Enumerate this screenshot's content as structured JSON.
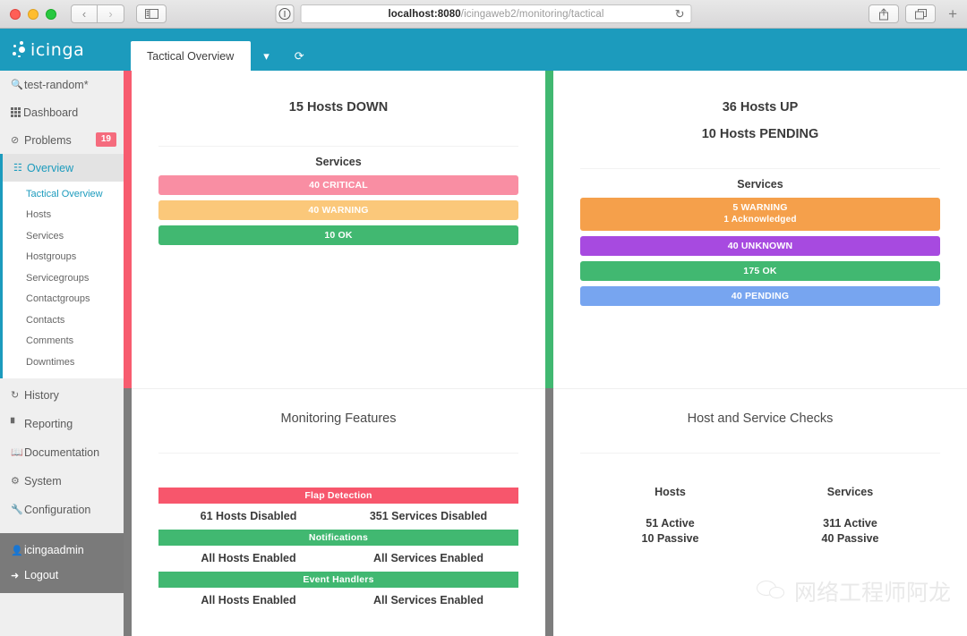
{
  "browser": {
    "back_label": "‹",
    "forward_label": "›",
    "sidebar_toggle_label": "sidebar-toggle",
    "url_host": "localhost:8080",
    "url_path": "/icingaweb2/monitoring/tactical",
    "reload_label": "↻",
    "share_label": "share",
    "tabs_label": "tabs",
    "new_tab_label": "+"
  },
  "sidebar": {
    "logo_text": "icinga",
    "search": {
      "icon": "search-icon",
      "value": "test-random*"
    },
    "items": [
      {
        "label": "Dashboard",
        "icon": "grid-icon"
      },
      {
        "label": "Problems",
        "icon": "ban-icon",
        "badge": "19"
      },
      {
        "label": "Overview",
        "icon": "sitemap-icon",
        "active": true
      }
    ],
    "submenu": [
      {
        "label": "Tactical Overview",
        "current": true
      },
      {
        "label": "Hosts"
      },
      {
        "label": "Services"
      },
      {
        "label": "Hostgroups"
      },
      {
        "label": "Servicegroups"
      },
      {
        "label": "Contactgroups"
      },
      {
        "label": "Contacts"
      },
      {
        "label": "Comments"
      },
      {
        "label": "Downtimes"
      }
    ],
    "lower_items": [
      {
        "label": "History",
        "icon": "history-icon"
      },
      {
        "label": "Reporting",
        "icon": "bar-chart-icon"
      },
      {
        "label": "Documentation",
        "icon": "book-icon"
      },
      {
        "label": "System",
        "icon": "gears-icon"
      },
      {
        "label": "Configuration",
        "icon": "wrench-icon"
      }
    ],
    "user": {
      "label": "icingaadmin",
      "icon": "user-icon"
    },
    "logout": {
      "label": "Logout",
      "icon": "logout-icon"
    }
  },
  "tabbar": {
    "tab_label": "Tactical Overview",
    "dropdown_icon": "chevron-down-icon",
    "refresh_icon": "refresh-icon"
  },
  "panes": {
    "hosts_down": {
      "title": "15 Hosts DOWN",
      "services_label": "Services",
      "bars": [
        {
          "label": "40 CRITICAL",
          "color": "#f98ea3"
        },
        {
          "label": "40 WARNING",
          "color": "#fbc87a"
        },
        {
          "label": "10 OK",
          "color": "#41b871"
        }
      ],
      "strip_color": "#f75c6f"
    },
    "hosts_up": {
      "title": "36 Hosts UP",
      "subtitle": "10 Hosts PENDING",
      "services_label": "Services",
      "bars": [
        {
          "label": "5 WARNING",
          "sub": "1 Acknowledged",
          "color": "#f5a04b"
        },
        {
          "label": "40 UNKNOWN",
          "color": "#a council"
        }
      ],
      "strip_color": "#41b871"
    },
    "monitoring_features": {
      "title": "Monitoring Features",
      "rows": [
        {
          "name": "Flap Detection",
          "color": "#f7566c",
          "hosts": "61 Hosts Disabled",
          "services": "351 Services Disabled"
        },
        {
          "name": "Notifications",
          "color": "#41b871",
          "hosts": "All Hosts Enabled",
          "services": "All Services Enabled"
        },
        {
          "name": "Event Handlers",
          "color": "#41b871",
          "hosts": "All Hosts Enabled",
          "services": "All Services Enabled"
        }
      ],
      "strip_color": "#7d7d7d"
    },
    "host_service_checks": {
      "title": "Host and Service Checks",
      "col_hosts": "Hosts",
      "col_services": "Services",
      "hosts_active": "51 Active",
      "hosts_passive": "10 Passive",
      "services_active": "311 Active",
      "services_passive": "40 Passive",
      "strip_color": "#7d7d7d"
    }
  },
  "hosts_up_bars": [
    {
      "label": "5 WARNING",
      "sub": "1 Acknowledged",
      "color": "#f5a04b"
    },
    {
      "label": "40 UNKNOWN",
      "sub": "",
      "color": "#a74ae0"
    },
    {
      "label": "175 OK",
      "sub": "",
      "color": "#41b871"
    },
    {
      "label": "40 PENDING",
      "sub": "",
      "color": "#77a5f0"
    }
  ],
  "watermark": {
    "text": "网络工程师阿龙",
    "icon": "wechat-icon"
  }
}
